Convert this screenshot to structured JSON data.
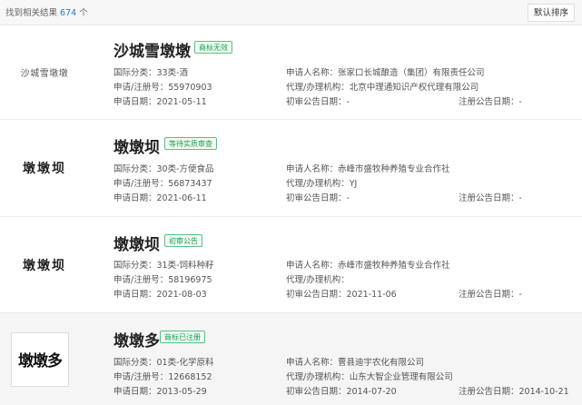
{
  "header": {
    "found_prefix": "找到相关结果",
    "found_count": "674",
    "found_suffix": "个",
    "sort_button": "默认排序"
  },
  "results": [
    {
      "logo_text": "沙城雪墩墩",
      "name": "沙城雪墩墩",
      "status": "商标无效",
      "intl_class": "国际分类：33类-酒",
      "reg_no": "申请/注册号：55970903",
      "apply_date": "申请日期：2021-05-11",
      "applicant": "申请人名称：张家口长城酿造（集团）有限责任公司",
      "agent": "代理/办理机构：北京中理通知识产权代理有限公司",
      "prelim_date": "初审公告日期：-",
      "reg_date": "注册公告日期：-"
    },
    {
      "logo_text": "墩墩坝",
      "name": "墩墩坝",
      "status": "等待实质审查",
      "intl_class": "国际分类：30类-方便食品",
      "reg_no": "申请/注册号：56873437",
      "apply_date": "申请日期：2021-06-11",
      "applicant": "申请人名称：赤峰市盛牧种养殖专业合作社",
      "agent": "代理/办理机构：YJ",
      "prelim_date": "初审公告日期：-",
      "reg_date": "注册公告日期：-"
    },
    {
      "logo_text": "墩墩坝",
      "name": "墩墩坝",
      "status": "初审公告",
      "intl_class": "国际分类：31类-饲料种籽",
      "reg_no": "申请/注册号：58196975",
      "apply_date": "申请日期：2021-08-03",
      "applicant": "申请人名称：赤峰市盛牧种养殖专业合作社",
      "agent": "代理/办理机构：",
      "prelim_date": "初审公告日期：2021-11-06",
      "reg_date": "注册公告日期：-"
    },
    {
      "logo_text": "墩墩多",
      "name": "墩墩多",
      "status": "商标已注册",
      "intl_class": "国际分类：01类-化学原料",
      "reg_no": "申请/注册号：12668152",
      "apply_date": "申请日期：2013-05-29",
      "applicant": "申请人名称：曹县迪宇农化有限公司",
      "agent": "代理/办理机构：山东大智企业管理有限公司",
      "prelim_date": "初审公告日期：2014-07-20",
      "reg_date": "注册公告日期：2014-10-21"
    }
  ]
}
